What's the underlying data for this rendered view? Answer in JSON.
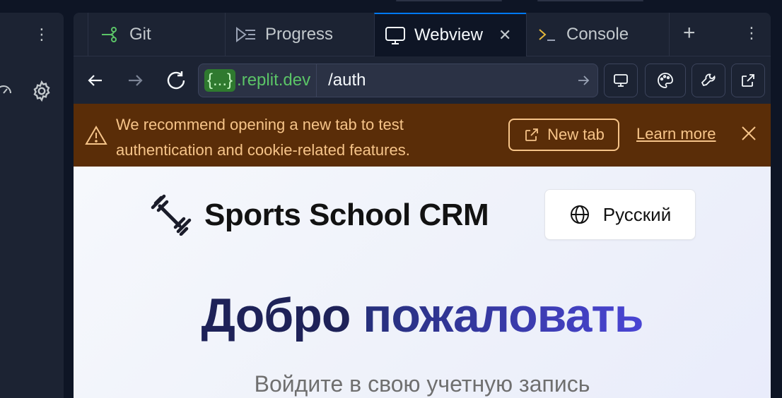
{
  "tabs": [
    {
      "label": "Git",
      "icon": "git-icon"
    },
    {
      "label": "Progress",
      "icon": "progress-icon"
    },
    {
      "label": "Webview",
      "icon": "monitor-icon",
      "active": true
    },
    {
      "label": "Console",
      "icon": "console-icon"
    }
  ],
  "urlbar": {
    "domain_brace": "{...}",
    "domain_suffix": ".replit.dev",
    "path": "/auth"
  },
  "banner": {
    "message": "We recommend opening a new tab to test authentication and cookie-related features.",
    "new_tab_label": "New tab",
    "learn_more_label": "Learn more"
  },
  "webview": {
    "brand": "Sports School CRM",
    "language": "Русский",
    "hero_word1": "Добро",
    "hero_word2": "пожаловать",
    "subtitle": "Войдите в свою учетную запись"
  },
  "colors": {
    "accent": "#0079f2",
    "banner_bg": "#5a2d08",
    "banner_text": "#f6c489",
    "domain_green": "#5bc467",
    "hero_dark": "#1e2258",
    "hero_purple": "#4a45d4"
  }
}
